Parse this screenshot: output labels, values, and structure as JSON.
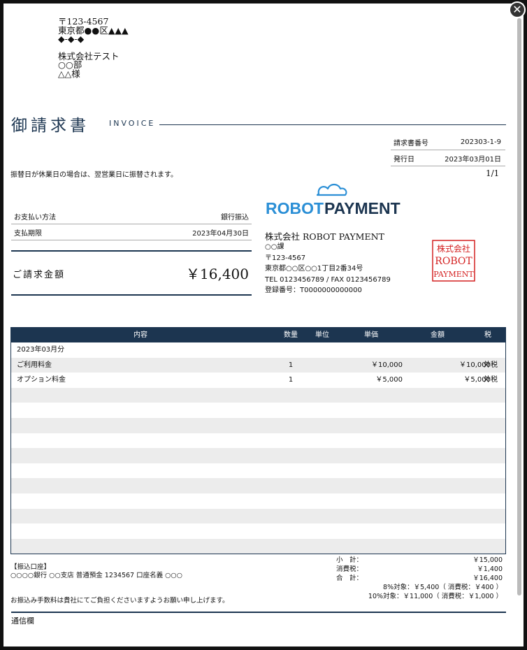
{
  "recipient": {
    "postal": "〒123-4567",
    "address1": "東京都●●区▲▲▲",
    "address2": "◆-◆-◆",
    "company": "株式会社テスト",
    "department": "○○部",
    "name": "△△様"
  },
  "title": {
    "jp": "御請求書",
    "en": "INVOICE"
  },
  "meta": {
    "invoice_no_label": "請求書番号",
    "invoice_no": "202303-1-9",
    "issue_date_label": "発行日",
    "issue_date": "2023年03月01日"
  },
  "notice": "振替日が休業日の場合は、翌営業日に振替されます。",
  "page_number": "1/1",
  "payment": {
    "method_label": "お支払い方法",
    "method": "銀行振込",
    "due_label": "支払期限",
    "due": "2023年04月30日"
  },
  "total": {
    "label": "ご請求金額",
    "value": "￥16,400"
  },
  "issuer": {
    "logo_text1": "ROBOT",
    "logo_text2": "PAYMENT",
    "company": "株式会社 ROBOT PAYMENT",
    "department": "○○課",
    "postal": "〒123-4567",
    "address": "東京都○○区○○1丁目2番34号",
    "tel_fax": "TEL 0123456789 / FAX 0123456789",
    "registration": "登録番号：T0000000000000",
    "stamp_top": "株式会社",
    "stamp_line2": "ROBOT",
    "stamp_line3": "PAYMENT",
    "brand_color": "#1c3550",
    "logo_blue": "#2b8fd6",
    "stamp_color": "#d42020"
  },
  "items": {
    "headers": {
      "name": "内容",
      "qty": "数量",
      "unit": "単位",
      "price": "単価",
      "amount": "金額",
      "tax": "税"
    },
    "period": "2023年03月分",
    "rows": [
      {
        "name": "ご利用料金",
        "qty": "1",
        "unit": "",
        "price": "￥10,000",
        "amount": "￥10,000",
        "tax": "外税"
      },
      {
        "name": "オプション料金",
        "qty": "1",
        "unit": "",
        "price": "￥5,000",
        "amount": "￥5,000",
        "tax": "外税"
      }
    ]
  },
  "bank": {
    "heading": "【振込口座】",
    "detail": "○○○○銀行 ○○支店 普通預金 1234567 口座名義 ○○○"
  },
  "fee_note": "お振込み手数料は貴社にてご負担くださいますようお願い申し上げます。",
  "summary": {
    "subtotal_label": "小　計：",
    "subtotal": "￥15,000",
    "tax_label": "消費税：",
    "tax": "￥1,400",
    "grand_label": "合　計：",
    "grand": "￥16,400",
    "rate8": "8%対象：￥5,400（ 消費税：￥400 ）",
    "rate10": "10%対象：￥11,000（ 消費税：￥1,000 ）"
  },
  "memo_label": "通信欄"
}
